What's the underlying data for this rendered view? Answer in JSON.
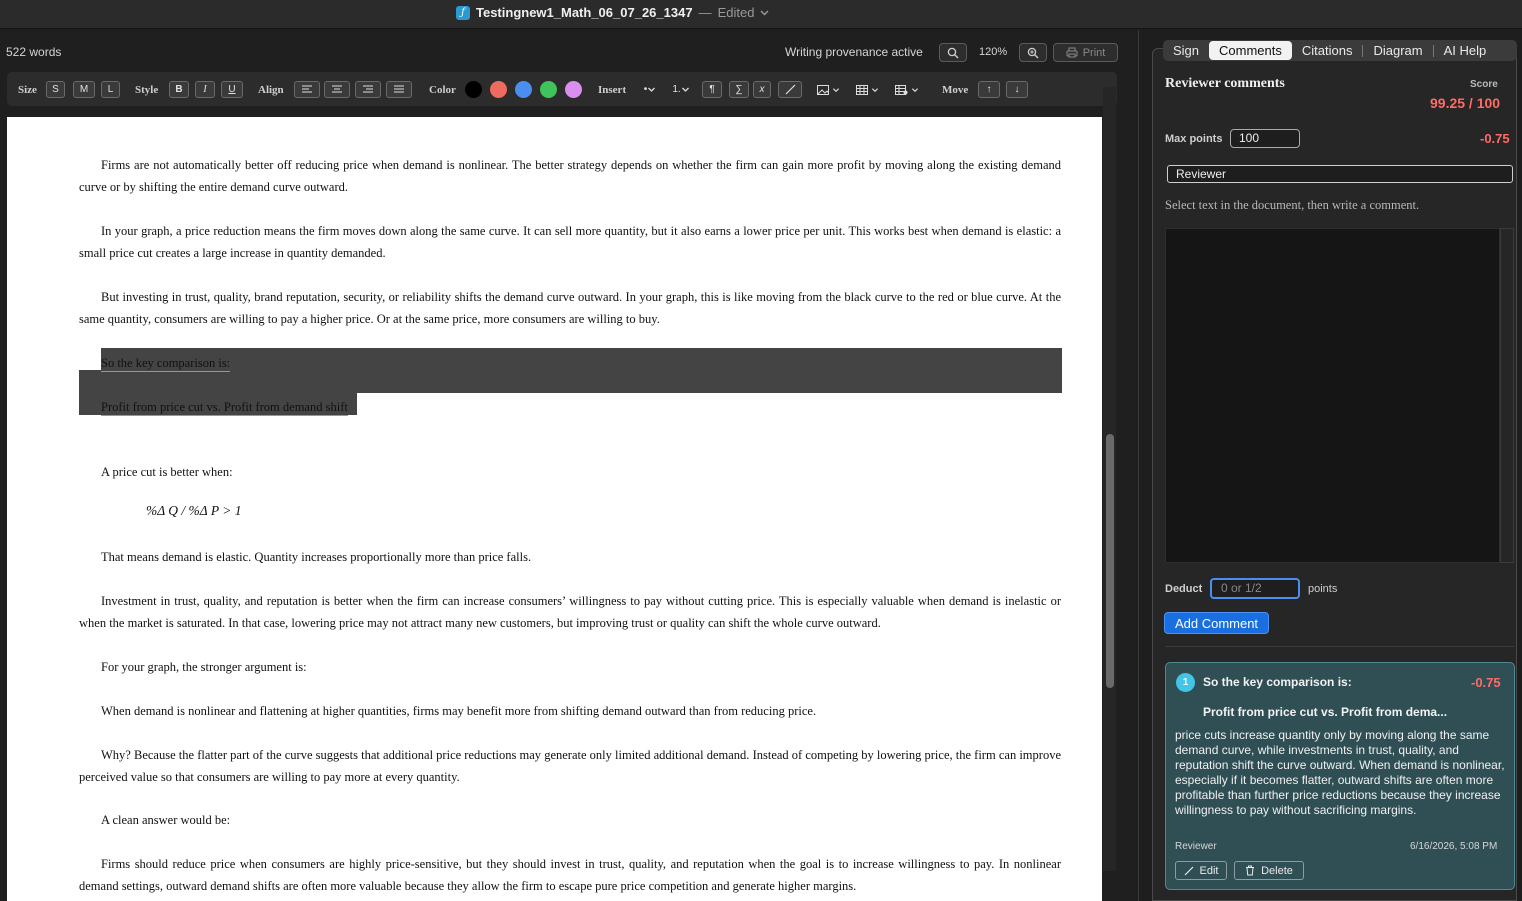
{
  "window": {
    "doc_title": "Testingnew1_Math_06_07_26_1347",
    "separator": "—",
    "state": "Edited"
  },
  "status": {
    "word_count": "522 words",
    "provenance": "Writing provenance active",
    "zoom": "120%",
    "print_label": "Print"
  },
  "toolbar": {
    "size_label": "Size",
    "size_s": "S",
    "size_m": "M",
    "size_l": "L",
    "style_label": "Style",
    "bold": "B",
    "italic": "I",
    "underline": "U",
    "align_label": "Align",
    "color_label": "Color",
    "insert_label": "Insert",
    "bullet": "•",
    "numbered": "1.",
    "pilcrow": "¶",
    "sigma": "∑",
    "x_label": "x",
    "move_label": "Move",
    "up": "↑",
    "down": "↓",
    "colors": [
      "#000000",
      "#ee6b5f",
      "#4a8ff0",
      "#3ec45a",
      "#d98ef0"
    ]
  },
  "document": {
    "p1": "Firms are not automatically better off reducing price when demand is nonlinear. The better strategy depends on whether the firm can gain more profit by moving along the existing demand curve or by shifting the entire demand curve outward.",
    "p2": "In your graph, a price reduction means the firm moves down along the same curve. It can sell more quantity, but it also earns a lower price per unit. This works best when demand is elastic: a small price cut creates a large increase in quantity demanded.",
    "p3": "But investing in trust, quality, brand reputation, security, or reliability shifts the demand curve outward. In your graph, this is like moving from the black curve to the red or blue curve. At the same quantity, consumers are willing to pay a higher price. Or at the same price, more consumers are willing to buy.",
    "hl1": "So the key comparison is:",
    "hl2": "Profit from price cut vs. Profit from demand shift",
    "p4": "A price cut is better when:",
    "formula": "%Δ Q / %Δ P > 1",
    "p5": "That means demand is elastic. Quantity increases proportionally more than price falls.",
    "p6": "Investment in trust, quality, and reputation is better when the firm can increase consumers’ willingness to pay without cutting price. This is especially valuable when demand is inelastic or when the market is saturated. In that case, lowering price may not attract many new customers, but improving trust or quality can shift the whole curve outward.",
    "p7": "For your graph, the stronger argument is:",
    "p8": "When demand is nonlinear and flattening at higher quantities, firms may benefit more from shifting demand outward than from reducing price.",
    "p9": "Why? Because the flatter part of the curve suggests that additional price reductions may generate only limited additional demand. Instead of competing by lowering price, the firm can improve perceived value so that consumers are willing to pay more at every quantity.",
    "p10": "A clean answer would be:",
    "p11": "Firms should reduce price when consumers are highly price-sensitive, but they should invest in trust, quality, and reputation when the goal is to increase willingness to pay. In nonlinear demand settings, outward demand shifts are often more valuable because they allow the firm to escape pure price competition and generate higher margins."
  },
  "panel": {
    "tabs": [
      "Sign",
      "Comments",
      "Citations",
      "Diagram",
      "AI Help"
    ],
    "active_tab": "Comments",
    "title": "Reviewer comments",
    "score_label": "Score",
    "score_value": "99.25 / 100",
    "max_points_label": "Max points",
    "max_points_value": "100",
    "total_delta": "-0.75",
    "reviewer_value": "Reviewer",
    "hint": "Select text in the document, then write a comment.",
    "deduct_label": "Deduct",
    "deduct_placeholder": "0 or 1/2",
    "points_label": "points",
    "add_button": "Add Comment"
  },
  "comment": {
    "number": "1",
    "title_line1": "So the key comparison is:",
    "title_line2": "Profit from price cut vs. Profit from dema...",
    "delta": "-0.75",
    "body": "price cuts increase quantity only by moving along the same demand curve, while investments in trust, quality, and reputation shift the curve outward. When demand is nonlinear, especially if it becomes flatter, outward shifts are often more profitable than further price reductions because they increase willingness to pay without sacrificing margins.",
    "author": "Reviewer",
    "date": "6/16/2026, 5:08 PM",
    "edit_label": "Edit",
    "delete_label": "Delete"
  }
}
